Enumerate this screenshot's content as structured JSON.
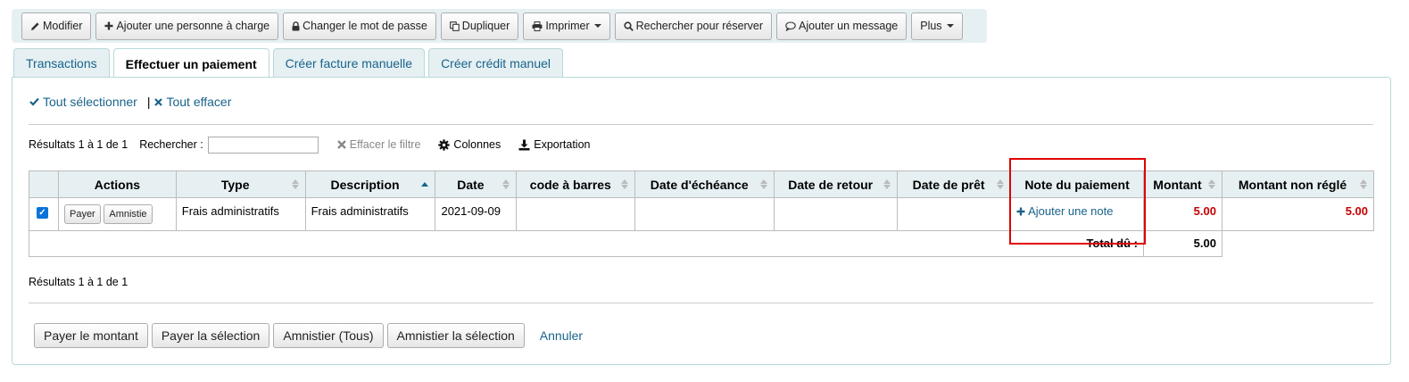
{
  "toolbar": {
    "buttons": [
      {
        "label": "Modifier",
        "icon": "pencil-icon"
      },
      {
        "label": "Ajouter une personne à charge",
        "icon": "plus-icon"
      },
      {
        "label": "Changer le mot de passe",
        "icon": "lock-icon"
      },
      {
        "label": "Dupliquer",
        "icon": "copy-icon"
      },
      {
        "label": "Imprimer",
        "icon": "print-icon"
      },
      {
        "label": "Rechercher pour réserver",
        "icon": "search-icon"
      },
      {
        "label": "Ajouter un message",
        "icon": "comment-icon"
      },
      {
        "label": "Plus",
        "icon": ""
      }
    ]
  },
  "tabs": [
    "Transactions",
    "Effectuer un paiement",
    "Créer facture manuelle",
    "Créer crédit manuel"
  ],
  "selection": {
    "select_all": "Tout sélectionner",
    "clear_all": "Tout effacer",
    "separator": "|"
  },
  "filter": {
    "results": "Résultats 1 à 1 de 1",
    "search_label": "Rechercher :",
    "search_value": "",
    "clear_filter": "Effacer le filtre",
    "columns": "Colonnes",
    "export": "Exportation"
  },
  "table": {
    "headers": [
      "Actions",
      "Type",
      "Description",
      "Date",
      "code à barres",
      "Date d'échéance",
      "Date de retour",
      "Date de prêt",
      "Note du paiement",
      "Montant",
      "Montant non réglé"
    ],
    "row": {
      "pay_button": "Payer",
      "forgive_button": "Amnistie",
      "type": "Frais administratifs",
      "description": "Frais administratifs",
      "date": "2021-09-09",
      "barcode": "",
      "due_date": "",
      "return_date": "",
      "checkout_date": "",
      "note_link": "Ajouter une note",
      "amount": "5.00",
      "outstanding": "5.00"
    },
    "total_label": "Total dû :",
    "total_value": "5.00"
  },
  "footer": {
    "results": "Résultats 1 à 1 de 1",
    "buttons": [
      "Payer le montant",
      "Payer la sélection",
      "Amnistier (Tous)",
      "Amnistier la sélection"
    ],
    "cancel": "Annuler"
  },
  "colors": {
    "link": "#19638b",
    "amount": "#c40000",
    "highlight": "#e00000",
    "header_bg": "#e6f0f2"
  }
}
